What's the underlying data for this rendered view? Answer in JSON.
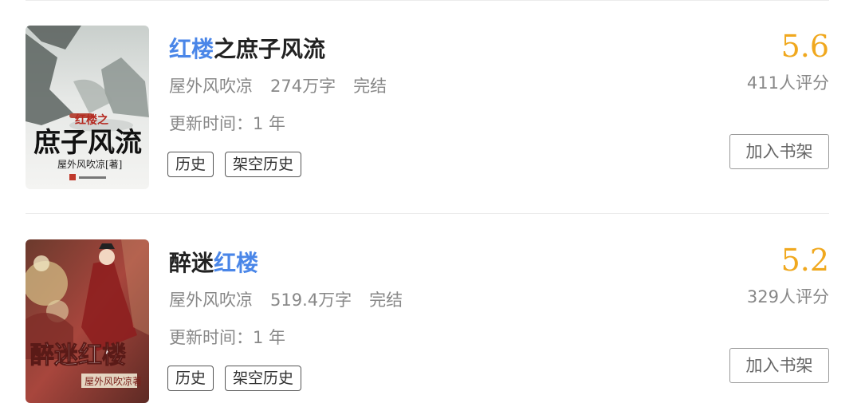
{
  "books": [
    {
      "title_highlight": "红楼",
      "title_rest": "之庶子风流",
      "author": "屋外风吹凉",
      "word_count": "274万字",
      "status": "完结",
      "update": "更新时间：1 年",
      "tags": [
        "历史",
        "架空历史"
      ],
      "score": "5.6",
      "rating_count": "411人评分",
      "shelf_label": "加入书架",
      "cover": {
        "title_small": "红楼之",
        "title_big": "庶子风流",
        "author_line": "屋外风吹凉[著]"
      }
    },
    {
      "title_prefix": "醉迷",
      "title_highlight": "红楼",
      "author": "屋外风吹凉",
      "word_count": "519.4万字",
      "status": "完结",
      "update": "更新时间：1 年",
      "tags": [
        "历史",
        "架空历史"
      ],
      "score": "5.2",
      "rating_count": "329人评分",
      "shelf_label": "加入书架",
      "cover": {
        "title_big": "醉迷红楼",
        "author_line": "屋外风吹凉著"
      }
    }
  ],
  "colors": {
    "highlight": "#4a86e8",
    "score": "#f0a81e"
  }
}
